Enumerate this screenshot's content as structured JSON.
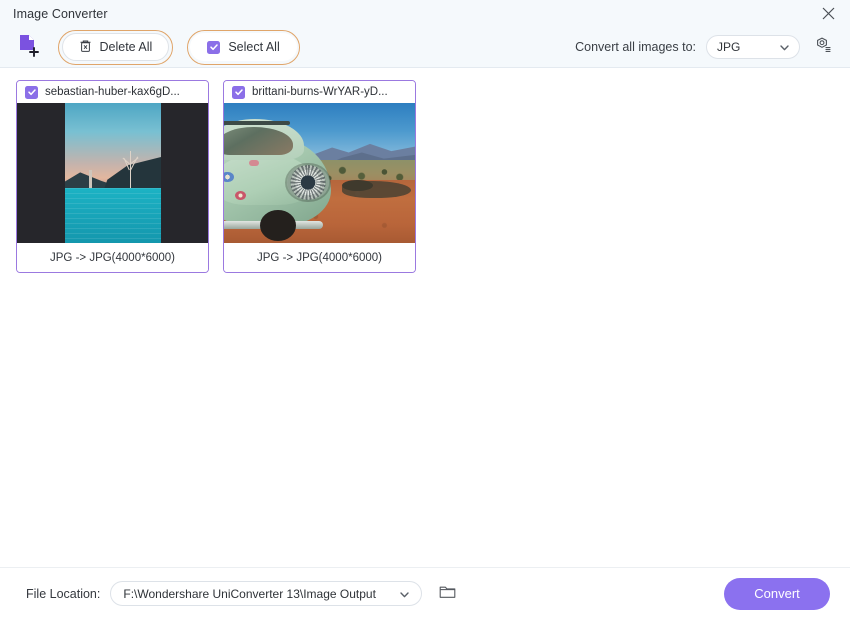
{
  "window": {
    "title": "Image Converter",
    "close_icon": "close-icon"
  },
  "toolbar": {
    "add_files_icon": "add-file-icon",
    "delete_all_label": "Delete All",
    "delete_icon": "trash-icon",
    "select_all_label": "Select All",
    "select_all_checked": true,
    "convert_all_label": "Convert all images to:",
    "format_value": "JPG",
    "format_caret_icon": "chevron-down-icon",
    "settings_icon": "gear-icon"
  },
  "files": [
    {
      "name": "sebastian-huber-kax6gD...",
      "checked": true,
      "conversion": "JPG -> JPG(4000*6000)"
    },
    {
      "name": "brittani-burns-WrYAR-yD...",
      "checked": true,
      "conversion": "JPG -> JPG(4000*6000)"
    }
  ],
  "footer": {
    "file_location_label": "File Location:",
    "file_location_value": "F:\\Wondershare UniConverter 13\\Image Output",
    "path_caret_icon": "chevron-down-icon",
    "browse_icon": "folder-icon",
    "convert_button_label": "Convert"
  },
  "colors": {
    "accent_purple": "#8b71ef",
    "card_border": "#9b79e0",
    "focus_ring": "#e0a56a",
    "header_bg": "#f5f9fc"
  }
}
